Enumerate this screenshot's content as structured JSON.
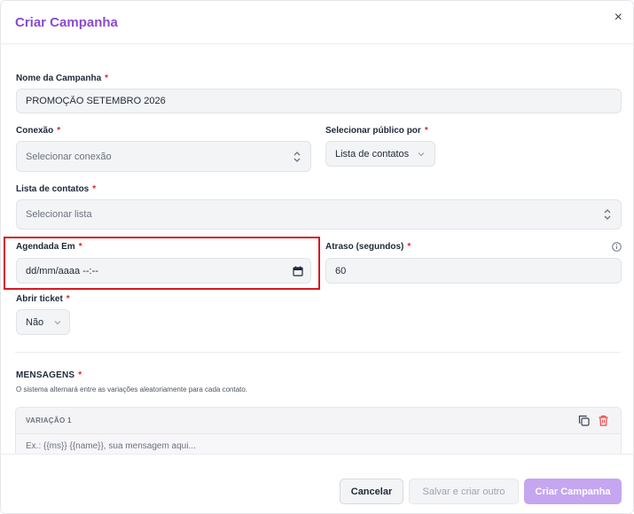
{
  "modal": {
    "title": "Criar Campanha",
    "close_symbol": "×"
  },
  "form": {
    "required_mark": "*",
    "campaign_name": {
      "label": "Nome da Campanha",
      "value": "PROMOÇÃO SETEMBRO 2026"
    },
    "connection": {
      "label": "Conexão",
      "placeholder": "Selecionar conexão"
    },
    "audience_by": {
      "label": "Selecionar público por",
      "value": "Lista de contatos"
    },
    "contact_list": {
      "label": "Lista de contatos",
      "placeholder": "Selecionar lista"
    },
    "scheduled_at": {
      "label": "Agendada Em",
      "placeholder": "dd/mm/aaaa --:--"
    },
    "delay": {
      "label": "Atraso (segundos)",
      "value": "60"
    },
    "open_ticket": {
      "label": "Abrir ticket",
      "value": "Não"
    }
  },
  "messages": {
    "title": "MENSAGENS",
    "description": "O sistema alternará entre as variações aleatoriamente para cada contato.",
    "variations": [
      {
        "label": "VARIAÇÃO 1",
        "placeholder": "Ex.: {{ms}} {{name}}, sua mensagem aqui..."
      }
    ]
  },
  "footer": {
    "cancel": "Cancelar",
    "save_and_create_another": "Salvar e criar outro",
    "create": "Criar Campanha"
  },
  "colors": {
    "accent": "#8a4bcf",
    "required": "#dc2626",
    "highlight_box": "#d71920",
    "primary_disabled": "#c5a6f0"
  }
}
